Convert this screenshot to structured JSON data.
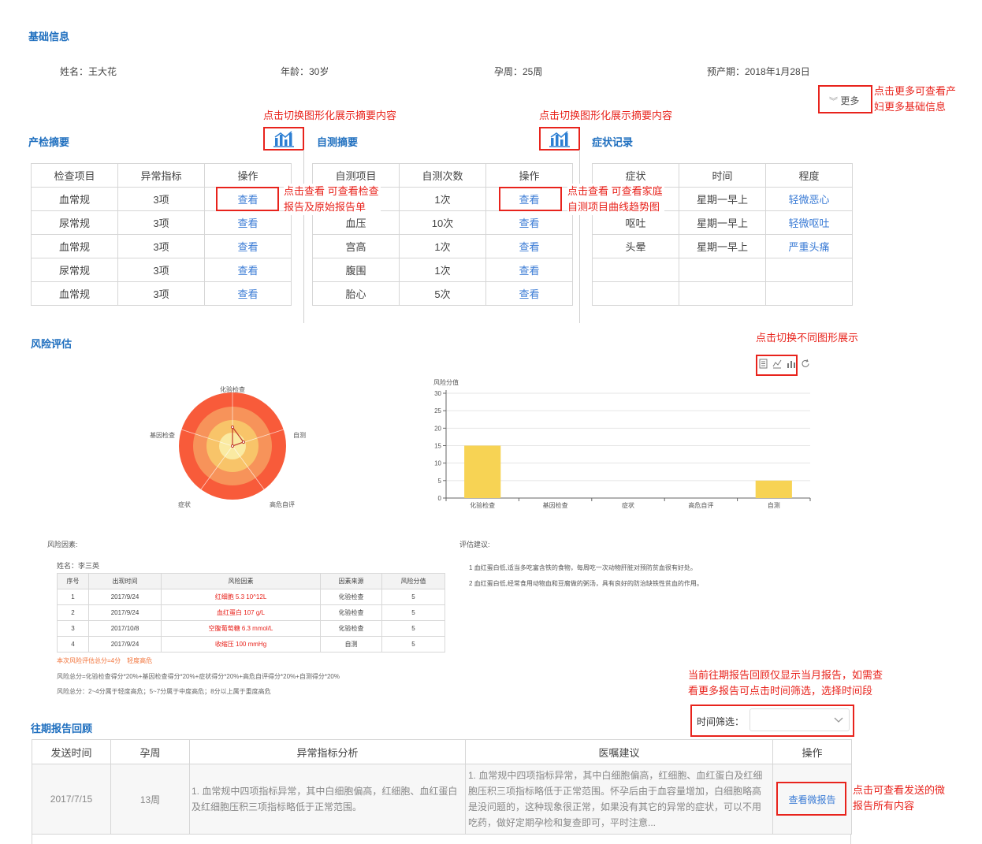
{
  "basic": {
    "title": "基础信息",
    "name": "姓名：王大花",
    "age": "年龄：30岁",
    "week": "孕周：25周",
    "due": "预产期：2018年1月28日",
    "more": "更多"
  },
  "notes": {
    "more_info": [
      "点击更多可查看产",
      "妇更多基础信息"
    ],
    "switch1": "点击切换图形化展示摘要内容",
    "switch2": "点击切换图形化展示摘要内容",
    "view_exam": [
      "点击查看 可查看检查",
      "报告及原始报告单"
    ],
    "view_self": [
      "点击查看 可查看家庭",
      "自测项目曲线趋势图"
    ],
    "switch_chart": "点击切换不同图形展示",
    "history_filter": [
      "当前往期报告回顾仅显示当月报告，如需查",
      "看更多报告可点击时间筛选，选择时间段"
    ],
    "view_report": [
      "点击可查看发送的微",
      "报告所有内容"
    ]
  },
  "exam": {
    "title": "产检摘要",
    "headers": [
      "检查项目",
      "异常指标",
      "操作"
    ],
    "rows": [
      [
        "血常规",
        "3项",
        "查看"
      ],
      [
        "尿常规",
        "3项",
        "查看"
      ],
      [
        "血常规",
        "3项",
        "查看"
      ],
      [
        "尿常规",
        "3项",
        "查看"
      ],
      [
        "血常规",
        "3项",
        "查看"
      ]
    ]
  },
  "self": {
    "title": "自测摘要",
    "headers": [
      "自测项目",
      "自测次数",
      "操作"
    ],
    "rows": [
      [
        "",
        "1次",
        "查看"
      ],
      [
        "血压",
        "10次",
        "查看"
      ],
      [
        "宫高",
        "1次",
        "查看"
      ],
      [
        "腹围",
        "1次",
        "查看"
      ],
      [
        "胎心",
        "5次",
        "查看"
      ]
    ]
  },
  "symptom": {
    "title": "症状记录",
    "headers": [
      "症状",
      "时间",
      "程度"
    ],
    "rows": [
      [
        "",
        "星期一早上",
        "轻微恶心"
      ],
      [
        "呕吐",
        "星期一早上",
        "轻微呕吐"
      ],
      [
        "头晕",
        "星期一早上",
        "严重头痛"
      ],
      [
        "",
        "",
        ""
      ],
      [
        "",
        "",
        ""
      ]
    ]
  },
  "risk": {
    "title": "风险评估",
    "factor_label": "风险因素:",
    "patient": "姓名：李三英",
    "table_headers": [
      "序号",
      "出现时间",
      "风险因素",
      "因素来源",
      "风险分值"
    ],
    "table_rows": [
      [
        "1",
        "2017/9/24",
        "红细胞 5.3 10^12L",
        "化验检查",
        "5"
      ],
      [
        "2",
        "2017/9/24",
        "血红蛋白 107 g/L",
        "化验检查",
        "5"
      ],
      [
        "3",
        "2017/10/8",
        "空腹葡萄糖 6.3 mmol/L",
        "化验检查",
        "5"
      ],
      [
        "4",
        "2017/9/24",
        "收缩压 100 mmHg",
        "自测",
        "5"
      ]
    ],
    "summary": "本次风险评估总分=4分　轻度高危",
    "formula": "风险总分=化验检查得分*20%+基因检查得分*20%+症状得分*20%+高危自评得分*20%+自测得分*20%",
    "levels": "风险总分：2~4分属于轻度高危；5~7分属于中度高危；8分以上属于重度高危",
    "advice_label": "评估建议:",
    "advice": [
      "1  血红蛋白低,适当多吃富含铁的食物，每周吃一次动物肝脏对预防贫血很有好处。",
      "2  血红蛋白低,经常食用动物血和豆腐做的粥汤，具有良好的防治缺铁性贫血的作用。"
    ]
  },
  "radar": {
    "labels": [
      "化验检查",
      "自测",
      "高危自评",
      "症状",
      "基因检查"
    ]
  },
  "chart_data": {
    "type": "bar",
    "title": "",
    "ylabel": "风险分值",
    "xlabel": "",
    "categories": [
      "化验检查",
      "基因检查",
      "症状",
      "高危自评",
      "自测"
    ],
    "values": [
      15,
      0,
      0,
      0,
      5
    ],
    "ylim": [
      0,
      30
    ],
    "yticks": [
      0,
      5,
      10,
      15,
      20,
      25,
      30
    ],
    "grid": true,
    "bar_color": "#f7d354"
  },
  "history": {
    "title": "往期报告回顾",
    "filter_label": "时间筛选：",
    "filter_value": "",
    "headers": [
      "发送时间",
      "孕周",
      "异常指标分析",
      "医嘱建议",
      "操作"
    ],
    "rows": [
      {
        "date": "2017/7/15",
        "week": "13周",
        "analysis": "1. 血常规中四项指标异常，其中白细胞偏高，红细胞、血红蛋白及红细胞压积三项指标略低于正常范围。",
        "advice": "1. 血常规中四项指标异常，其中白细胞偏高，红细胞、血红蛋白及红细胞压积三项指标略低于正常范围。怀孕后由于血容量增加，白细胞略高是没问题的，这种现象很正常，如果没有其它的异常的症状，可以不用吃药，做好定期孕检和复查即可，平时注意...",
        "action": "查看微报告"
      }
    ]
  },
  "colors": {
    "accent": "#1f6fbf",
    "link": "#3a7bd5",
    "annotation": "#e8231c"
  }
}
